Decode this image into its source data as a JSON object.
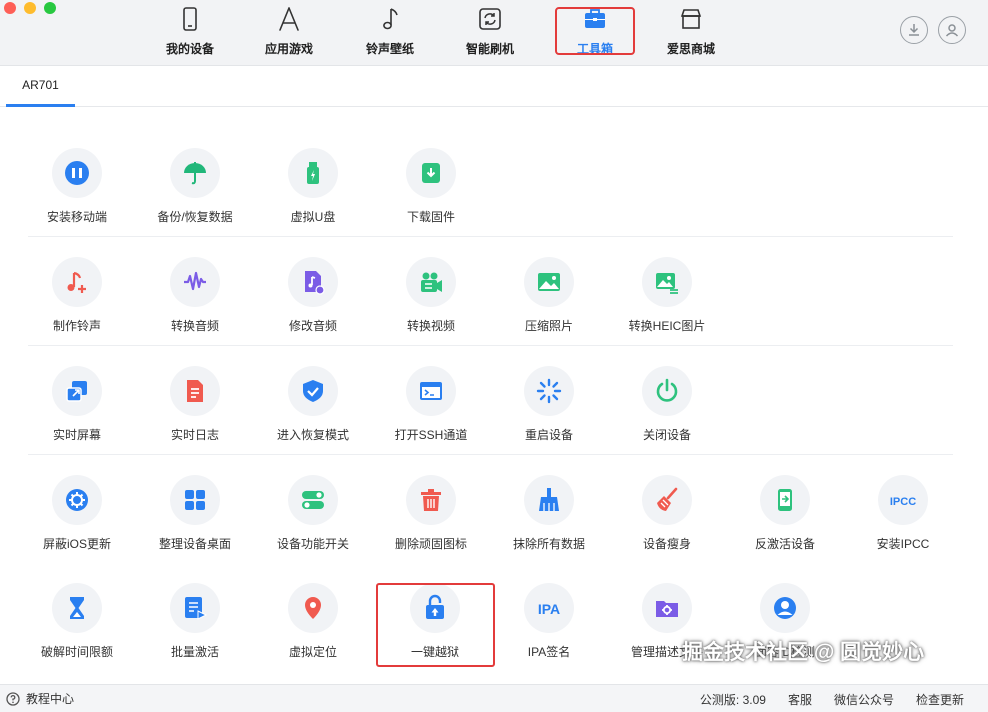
{
  "nav": {
    "items": [
      {
        "label": "我的设备",
        "icon": "phone-icon"
      },
      {
        "label": "应用游戏",
        "icon": "app-store-icon"
      },
      {
        "label": "铃声壁纸",
        "icon": "music-note-icon"
      },
      {
        "label": "智能刷机",
        "icon": "refresh-box-icon"
      },
      {
        "label": "工具箱",
        "icon": "toolbox-icon",
        "active": true
      },
      {
        "label": "爱思商城",
        "icon": "store-icon"
      }
    ],
    "active_color": "#2a7ff0",
    "highlight_color": "#e33b3b"
  },
  "device_tab": "AR701",
  "tools": {
    "row1": [
      {
        "label": "安装移动端",
        "icon": "install-mobile-icon",
        "color": "#2a7ff0"
      },
      {
        "label": "备份/恢复数据",
        "icon": "umbrella-icon",
        "color": "#21b77a"
      },
      {
        "label": "虚拟U盘",
        "icon": "usb-drive-icon",
        "color": "#2ec27e"
      },
      {
        "label": "下载固件",
        "icon": "download-firmware-icon",
        "color": "#2ec27e"
      }
    ],
    "row2": [
      {
        "label": "制作铃声",
        "icon": "ringtone-icon",
        "color": "#f05a4f"
      },
      {
        "label": "转换音频",
        "icon": "audio-wave-icon",
        "color": "#7b5ce6"
      },
      {
        "label": "修改音频",
        "icon": "audio-file-icon",
        "color": "#7b5ce6"
      },
      {
        "label": "转换视频",
        "icon": "video-camera-icon",
        "color": "#2ec27e"
      },
      {
        "label": "压缩照片",
        "icon": "photo-icon",
        "color": "#2ec27e"
      },
      {
        "label": "转换HEIC图片",
        "icon": "heic-image-icon",
        "color": "#2ec27e"
      }
    ],
    "row3": [
      {
        "label": "实时屏幕",
        "icon": "screen-share-icon",
        "color": "#2a7ff0"
      },
      {
        "label": "实时日志",
        "icon": "log-file-icon",
        "color": "#f05a4f"
      },
      {
        "label": "进入恢复模式",
        "icon": "shield-check-icon",
        "color": "#2a7ff0"
      },
      {
        "label": "打开SSH通道",
        "icon": "terminal-icon",
        "color": "#2a7ff0"
      },
      {
        "label": "重启设备",
        "icon": "restart-spinner-icon",
        "color": "#2a7ff0"
      },
      {
        "label": "关闭设备",
        "icon": "power-icon",
        "color": "#2ec27e"
      }
    ],
    "row4": [
      {
        "label": "屏蔽iOS更新",
        "icon": "block-update-icon",
        "color": "#2a7ff0"
      },
      {
        "label": "整理设备桌面",
        "icon": "grid-apps-icon",
        "color": "#2a7ff0"
      },
      {
        "label": "设备功能开关",
        "icon": "toggle-switch-icon",
        "color": "#2ec27e"
      },
      {
        "label": "删除顽固图标",
        "icon": "trash-icon",
        "color": "#f05a4f"
      },
      {
        "label": "抹除所有数据",
        "icon": "erase-broom-icon",
        "color": "#2a7ff0"
      },
      {
        "label": "设备瘦身",
        "icon": "cleanup-broom-icon",
        "color": "#f05a4f"
      },
      {
        "label": "反激活设备",
        "icon": "deactivate-phone-icon",
        "color": "#2ec27e"
      },
      {
        "label": "安装IPCC",
        "icon": "ipcc-icon",
        "color": "#2a7ff0",
        "icon_text": "IPCC"
      }
    ],
    "row5": [
      {
        "label": "破解时间限额",
        "icon": "hourglass-icon",
        "color": "#2a7ff0"
      },
      {
        "label": "批量激活",
        "icon": "batch-activate-icon",
        "color": "#2a7ff0"
      },
      {
        "label": "虚拟定位",
        "icon": "location-pin-icon",
        "color": "#f05a4f"
      },
      {
        "label": "一键越狱",
        "icon": "unlock-icon",
        "color": "#2a7ff0"
      },
      {
        "label": "IPA签名",
        "icon": "ipa-icon",
        "color": "#2a7ff0",
        "icon_text": "IPA"
      },
      {
        "label": "管理描述文件",
        "icon": "profile-folder-icon",
        "color": "#7b5ce6"
      },
      {
        "label": "面容ID检测",
        "icon": "face-id-icon",
        "color": "#2a7ff0"
      }
    ]
  },
  "status": {
    "help": "教程中心",
    "version": "公测版: 3.09",
    "service": "客服",
    "wechat": "微信公众号",
    "update": "检查更新"
  },
  "watermark": "掘金技术社区 @ 圆觉妙心"
}
